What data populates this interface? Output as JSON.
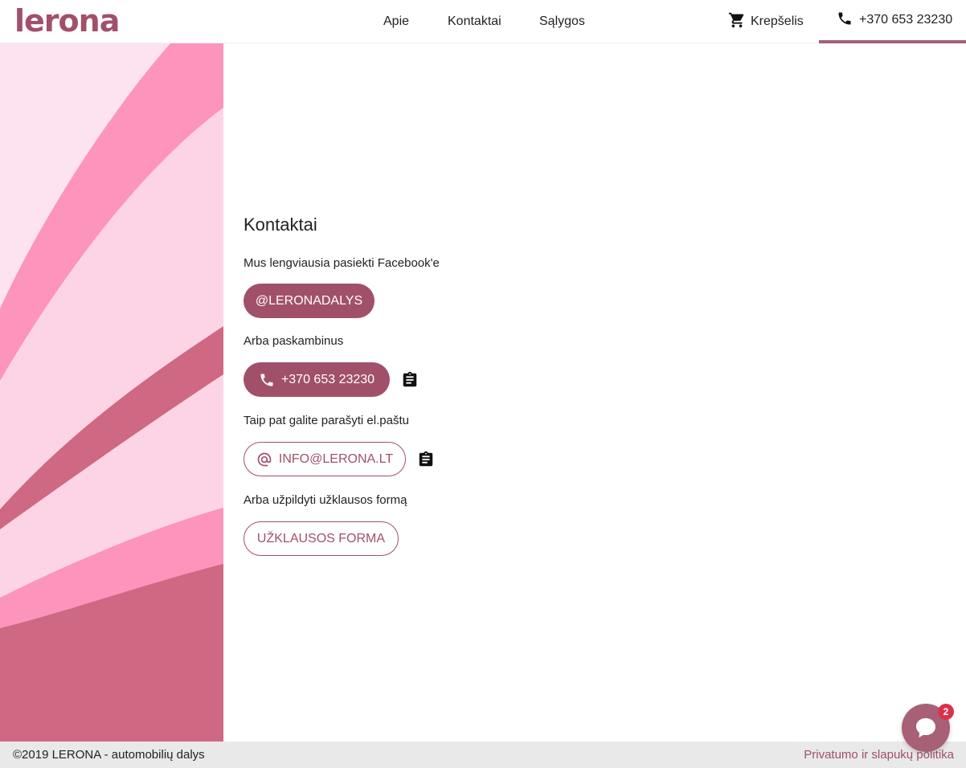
{
  "brand": {
    "logo": "lerona",
    "color": "#a1506a"
  },
  "nav": {
    "apie": "Apie",
    "kontaktai": "Kontaktai",
    "salygos": "Sąlygos"
  },
  "header": {
    "cart_label": "Krepšelis",
    "phone": "+370 653 23230"
  },
  "main": {
    "title": "Kontaktai",
    "facebook_text": "Mus lengviausia pasiekti Facebook'e",
    "facebook_button": "@LERONADALYS",
    "call_text": "Arba paskambinus",
    "phone_button": "+370 653 23230",
    "email_text": "Taip pat galite parašyti el.paštu",
    "email_button": "INFO@LERONA.LT",
    "form_text": "Arba užpildyti užklausos formą",
    "form_button": "UŽKLAUSOS FORMA"
  },
  "footer": {
    "copyright": "©2019 LERONA - automobilių dalys",
    "privacy_link": "Privatumo ir slapukų politika"
  },
  "chat": {
    "badge_count": "2",
    "icon": "chat-bubble-icon"
  },
  "icons": {
    "cart": "cart-icon",
    "phone": "phone-icon",
    "clipboard": "clipboard-icon",
    "at": "at-icon"
  }
}
